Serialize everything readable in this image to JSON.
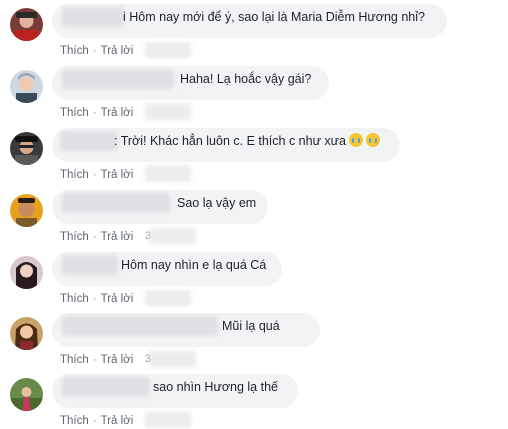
{
  "actions": {
    "like": "Thích",
    "reply": "Trả lời"
  },
  "comments": [
    {
      "text": "i Hôm nay mới để ý, sao lại là Maria Diễm Hương nhỉ?"
    },
    {
      "text": "Haha! Lạ hoắc vậy gái?"
    },
    {
      "text": ": Trời! Khác hẳn luôn c. E thích c như xưa",
      "emoji": "crying-face-emoji"
    },
    {
      "text": "Sao lạ vậy em"
    },
    {
      "text": "Hôm nay nhìn e lạ quá Cá"
    },
    {
      "text": "Mũi lạ quá"
    },
    {
      "text": "sao nhìn Hương lạ thế"
    }
  ],
  "time_glyph": "3"
}
